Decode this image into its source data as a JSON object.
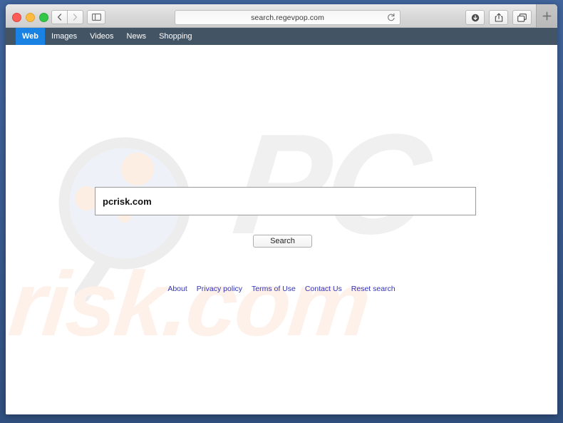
{
  "window": {
    "traffic_lights": [
      "close",
      "minimize",
      "maximize"
    ],
    "back_label": "Back",
    "forward_label": "Forward",
    "sidebar_label": "Show sidebar",
    "download_label": "Downloads",
    "share_label": "Share",
    "tabs_label": "Show all tabs",
    "new_tab_label": "+"
  },
  "address": {
    "url": "search.regevpop.com",
    "reload_label": "Reload"
  },
  "site_nav": {
    "items": [
      {
        "label": "Web",
        "active": true
      },
      {
        "label": "Images",
        "active": false
      },
      {
        "label": "Videos",
        "active": false
      },
      {
        "label": "News",
        "active": false
      },
      {
        "label": "Shopping",
        "active": false
      }
    ]
  },
  "search": {
    "query": "pcrisk.com",
    "placeholder": "",
    "button_label": "Search"
  },
  "footer": {
    "links": [
      "About",
      "Privacy policy",
      "Terms of Use",
      "Contact Us",
      "Reset search"
    ]
  },
  "watermarks": {
    "pc_text": "PC",
    "riskcom_text": "risk.com",
    "magnifier": "magnifier-watermark"
  },
  "colors": {
    "nav_bar": "#435465",
    "nav_active": "#1a82e2",
    "desktop": "#3d6199",
    "link": "#3333bb",
    "watermark_gray": "#f0f0f0",
    "watermark_peach": "#fdf1e9"
  }
}
